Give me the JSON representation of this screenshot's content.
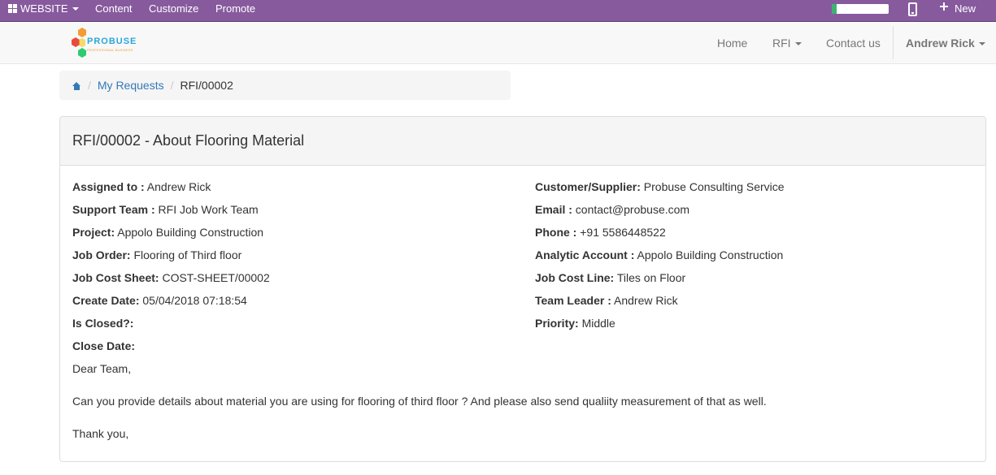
{
  "editor_bar": {
    "website_label": "WEBSITE",
    "menus": [
      "Content",
      "Customize",
      "Promote"
    ],
    "new_label": "New",
    "progress_fraction": 0.08,
    "background_color": "#875a9e"
  },
  "navbar": {
    "logo_text": "PROBUSE",
    "logo_subtext": "PROFESSIONAL BUSINESS",
    "links": [
      "Home",
      "RFI",
      "Contact us"
    ],
    "user": "Andrew Rick"
  },
  "breadcrumb": {
    "items": [
      "My Requests",
      "RFI/00002"
    ]
  },
  "panel": {
    "title": "RFI/00002 - About Flooring Material",
    "left_fields": [
      {
        "label": "Assigned to :",
        "value": "Andrew Rick"
      },
      {
        "label": "Support Team :",
        "value": "RFI Job Work Team"
      },
      {
        "label": "Project:",
        "value": "Appolo Building Construction"
      },
      {
        "label": "Job Order:",
        "value": "Flooring of Third floor"
      },
      {
        "label": "Job Cost Sheet:",
        "value": "COST-SHEET/00002"
      },
      {
        "label": "Create Date:",
        "value": "05/04/2018 07:18:54"
      },
      {
        "label": "Is Closed?:",
        "value": ""
      },
      {
        "label": "Close Date:",
        "value": ""
      }
    ],
    "right_fields": [
      {
        "label": "Customer/Supplier:",
        "value": "Probuse Consulting Service"
      },
      {
        "label": "Email :",
        "value": "contact@probuse.com"
      },
      {
        "label": "Phone :",
        "value": "+91 5586448522"
      },
      {
        "label": "Analytic Account :",
        "value": "Appolo Building Construction"
      },
      {
        "label": "Job Cost Line:",
        "value": "Tiles on Floor"
      },
      {
        "label": "Team Leader :",
        "value": "Andrew Rick"
      },
      {
        "label": "Priority:",
        "value": "Middle"
      }
    ],
    "message": {
      "greeting": "Dear Team,",
      "body": "Can you provide details about material you are using for flooring of third floor ? And please also send qualiity measurement of that as well.",
      "closing": "Thank you,"
    }
  }
}
